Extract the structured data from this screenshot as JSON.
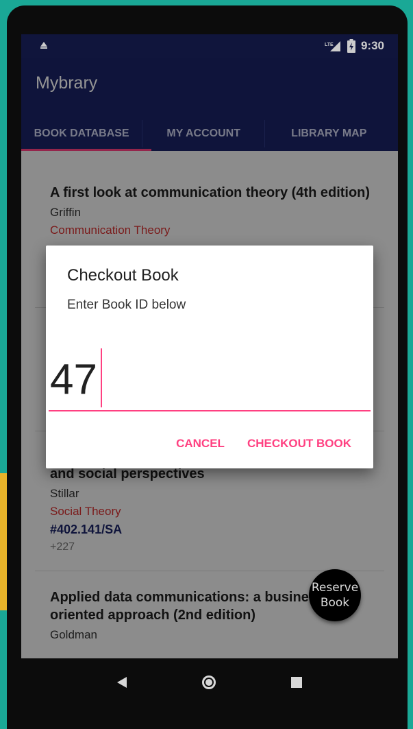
{
  "status_bar": {
    "time": "9:30",
    "network_label": "LTE",
    "icons": [
      "notification-icon",
      "signal-icon",
      "battery-icon"
    ]
  },
  "app_bar": {
    "title": "Mybrary",
    "tabs": [
      {
        "label": "BOOK DATABASE",
        "selected": true
      },
      {
        "label": "MY ACCOUNT",
        "selected": false
      },
      {
        "label": "LIBRARY MAP",
        "selected": false
      }
    ]
  },
  "books": [
    {
      "title": "A first look at communication theory (4th edition)",
      "author": "Griffin",
      "subject": "Communication Theory"
    },
    {
      "title": "and social perspectives",
      "author": "Stillar",
      "subject": "Social Theory",
      "code": "#402.141/SA",
      "extra": "+227"
    },
    {
      "title": "Applied data communications: a business oriented approach (2nd edition)",
      "author": "Goldman"
    }
  ],
  "dialog": {
    "title": "Checkout Book",
    "message": "Enter Book ID below",
    "input_value": "47",
    "cancel_label": "CANCEL",
    "confirm_label": "CHECKOUT BOOK"
  },
  "fab": {
    "label_line1": "Reserve",
    "label_line2": "Book"
  },
  "colors": {
    "primary": "#1a2466",
    "primary_dark": "#151b4b",
    "accent": "#ff4081",
    "subject_red": "#d32f2f"
  }
}
